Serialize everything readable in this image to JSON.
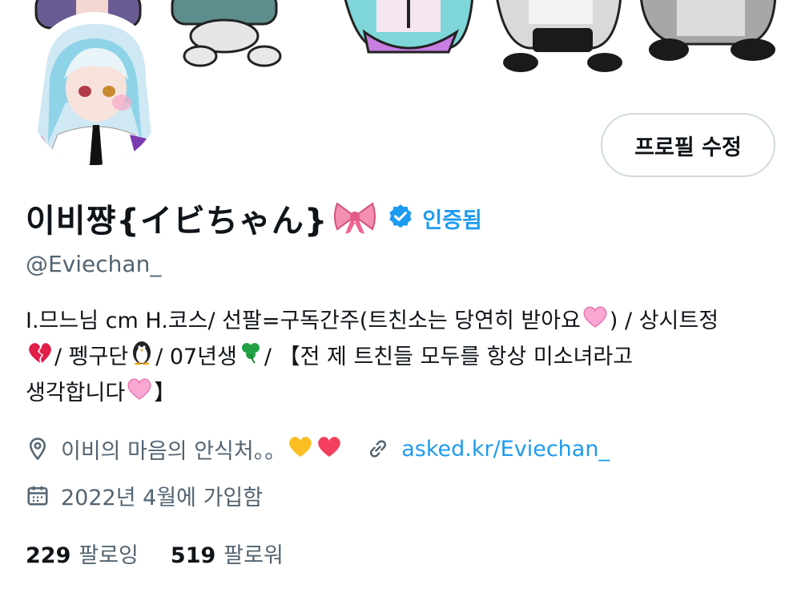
{
  "profile": {
    "display_name": "이비쨩{イビちゃん}",
    "verified_label": "인증됨",
    "handle": "@Eviechan_",
    "edit_button": "프로필 수정"
  },
  "bio": {
    "line1_a": "I.므느님 cm H.코스/ 선팔=구독간주(트친소는 당연히 받아요",
    "line1_b": ") / 상시트정",
    "line2_a": "/ 펭구단",
    "line2_b": "/ 07년생",
    "line2_c": "/ 【전 제 트친들 모두를 항상 미소녀라고",
    "line3_a": "생각합니다",
    "line3_b": "】"
  },
  "meta": {
    "location": "이비의 마음의 안식처。。",
    "link": "asked.kr/Eviechan_",
    "joined": "2022년 4월에 가입함"
  },
  "stats": {
    "following_count": "229",
    "following_label": "팔로잉",
    "followers_count": "519",
    "followers_label": "팔로워"
  },
  "icons": {
    "location": "location-pin-icon",
    "link": "link-icon",
    "calendar": "calendar-icon",
    "verified": "verified-badge-icon"
  },
  "colors": {
    "accent": "#1d9bf0",
    "muted": "#536471",
    "text": "#0f1419",
    "border": "#cfd9de"
  }
}
